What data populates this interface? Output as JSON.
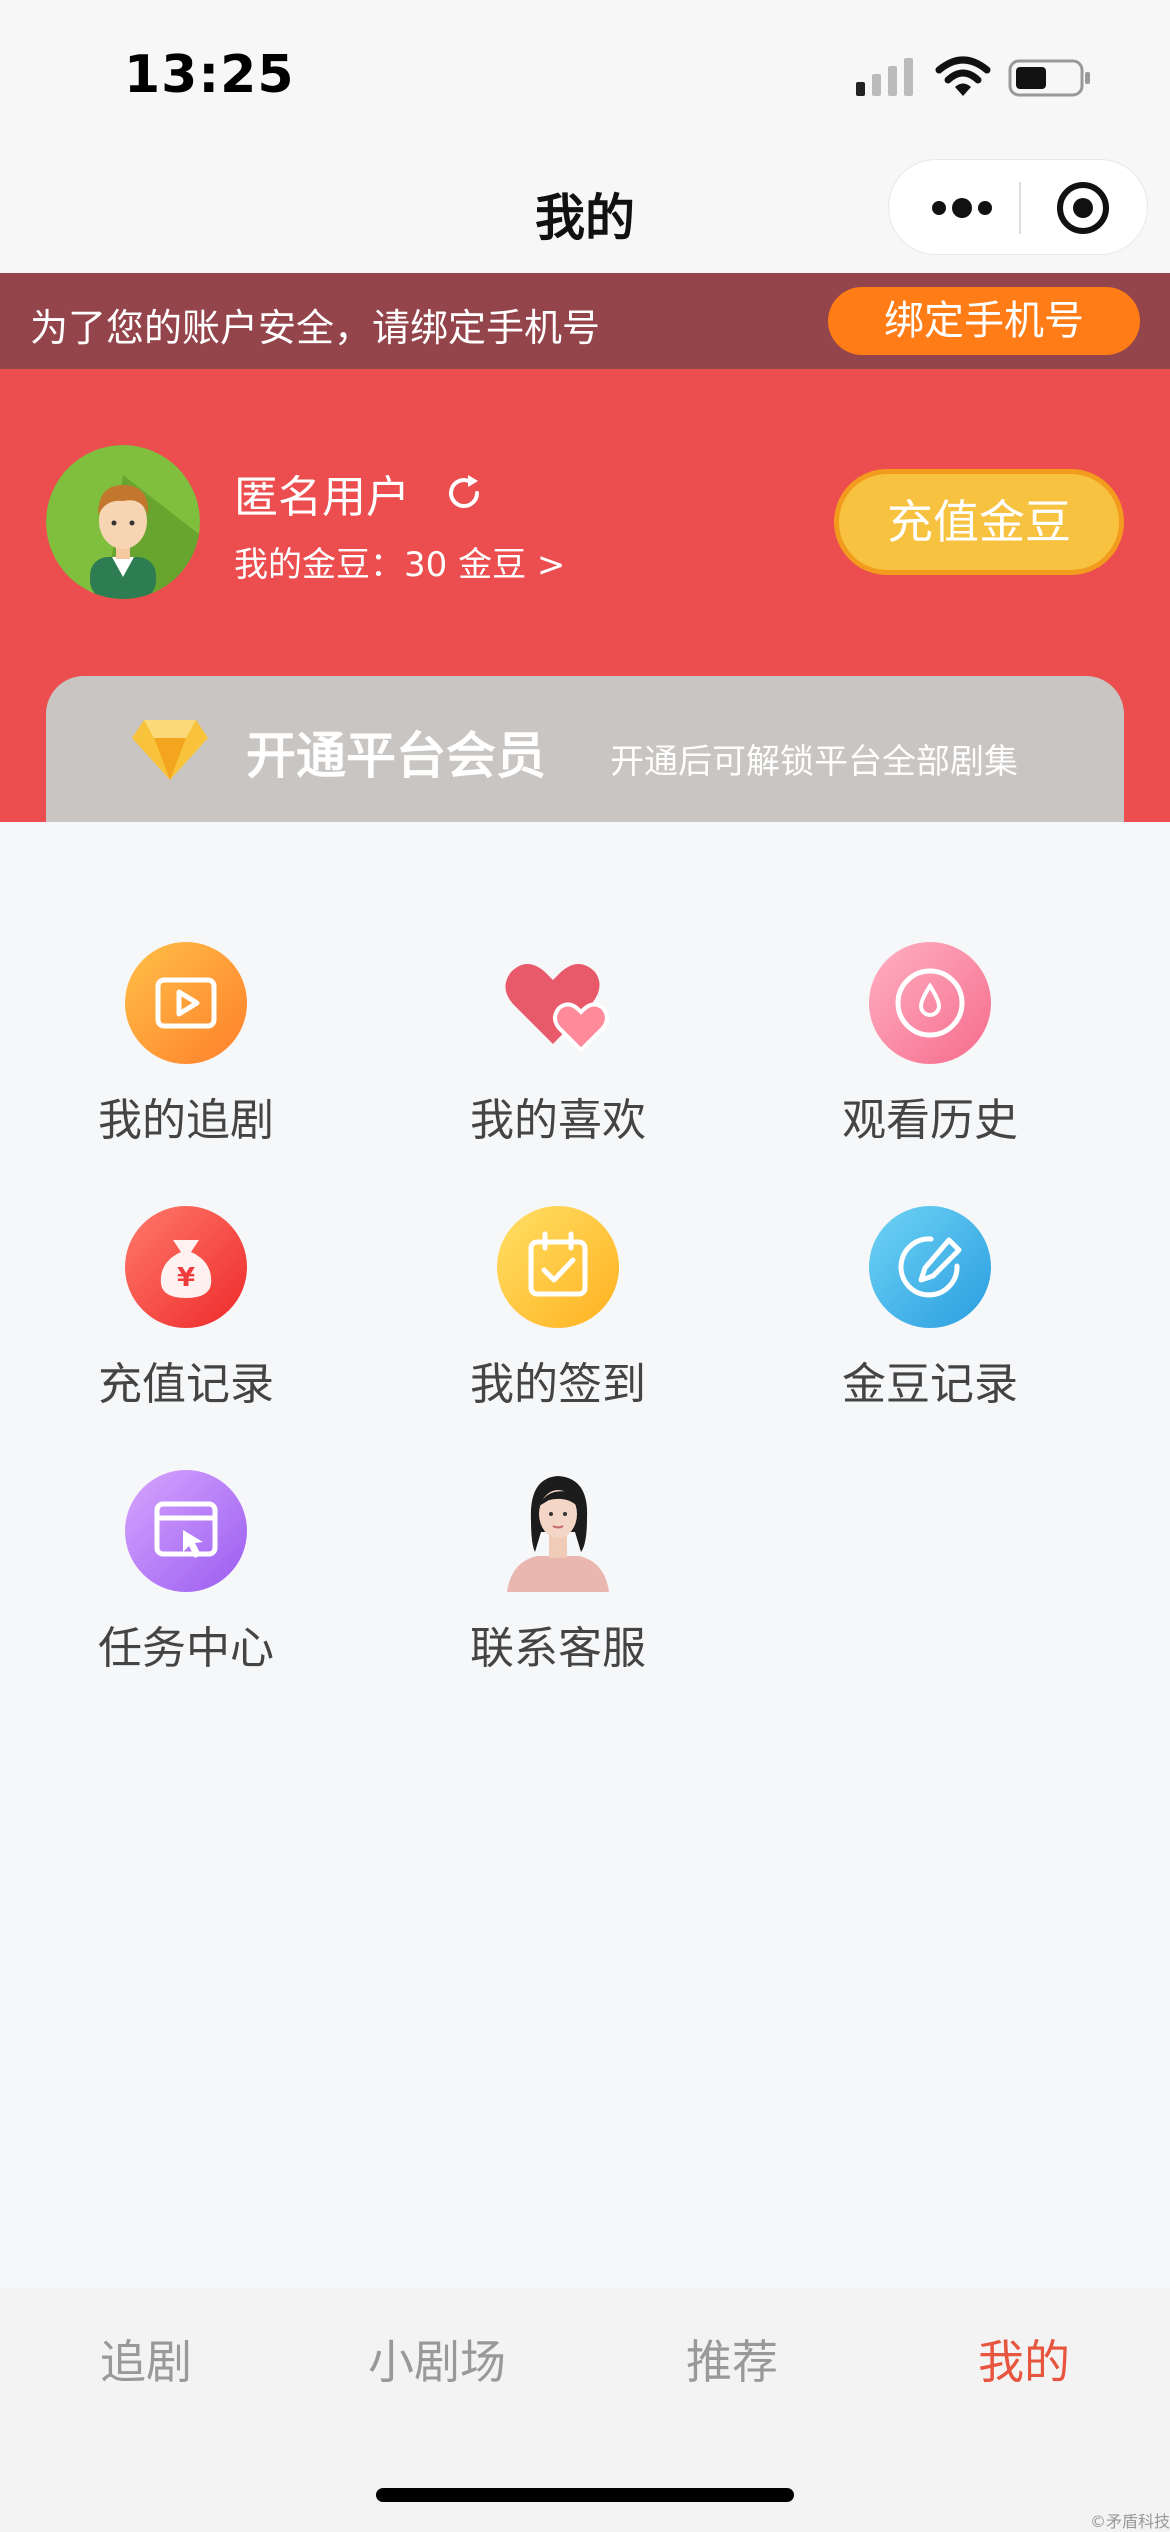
{
  "status": {
    "time": "13:25"
  },
  "nav": {
    "title": "我的"
  },
  "bind": {
    "text": "为了您的账户安全，请绑定手机号",
    "button": "绑定手机号"
  },
  "user": {
    "name": "匿名用户",
    "coins": "我的金豆：30 金豆 >",
    "recharge": "充值金豆"
  },
  "vip": {
    "title": "开通平台会员",
    "subtitle": "开通后可解锁平台全部剧集"
  },
  "menu": [
    {
      "label": "我的追剧",
      "icon": "play-video-icon"
    },
    {
      "label": "我的喜欢",
      "icon": "hearts-icon"
    },
    {
      "label": "观看历史",
      "icon": "history-dial-icon"
    },
    {
      "label": "充值记录",
      "icon": "money-bag-icon"
    },
    {
      "label": "我的签到",
      "icon": "calendar-check-icon"
    },
    {
      "label": "金豆记录",
      "icon": "pencil-circle-icon"
    },
    {
      "label": "任务中心",
      "icon": "task-board-icon"
    },
    {
      "label": "联系客服",
      "icon": "customer-service-photo"
    }
  ],
  "tabs": [
    {
      "label": "追剧"
    },
    {
      "label": "小剧场"
    },
    {
      "label": "推荐"
    },
    {
      "label": "我的"
    }
  ],
  "watermark": "©矛盾科技"
}
